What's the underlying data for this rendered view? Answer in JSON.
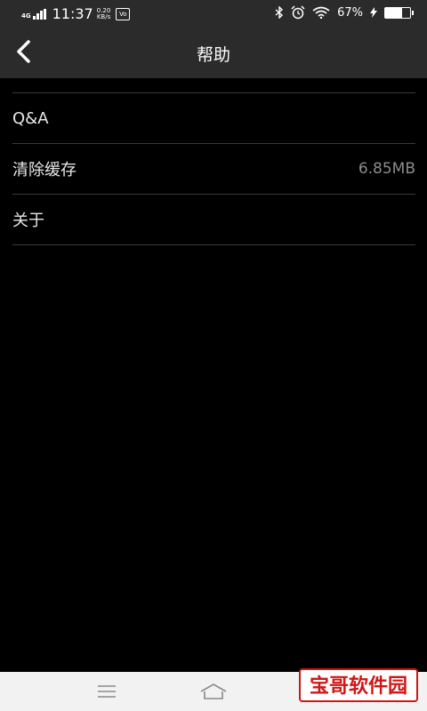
{
  "status_bar": {
    "network": "4G",
    "time": "11:37",
    "speed_value": "0.20",
    "speed_unit": "KB/s",
    "vo_label": "Vo",
    "battery_percent": "67%",
    "battery_level": 0.67
  },
  "header": {
    "title": "帮助"
  },
  "menu": {
    "items": [
      {
        "label": "Q&A",
        "value": ""
      },
      {
        "label": "清除缓存",
        "value": "6.85MB"
      },
      {
        "label": "关于",
        "value": ""
      }
    ]
  },
  "watermark": {
    "text": "宝哥软件园"
  }
}
